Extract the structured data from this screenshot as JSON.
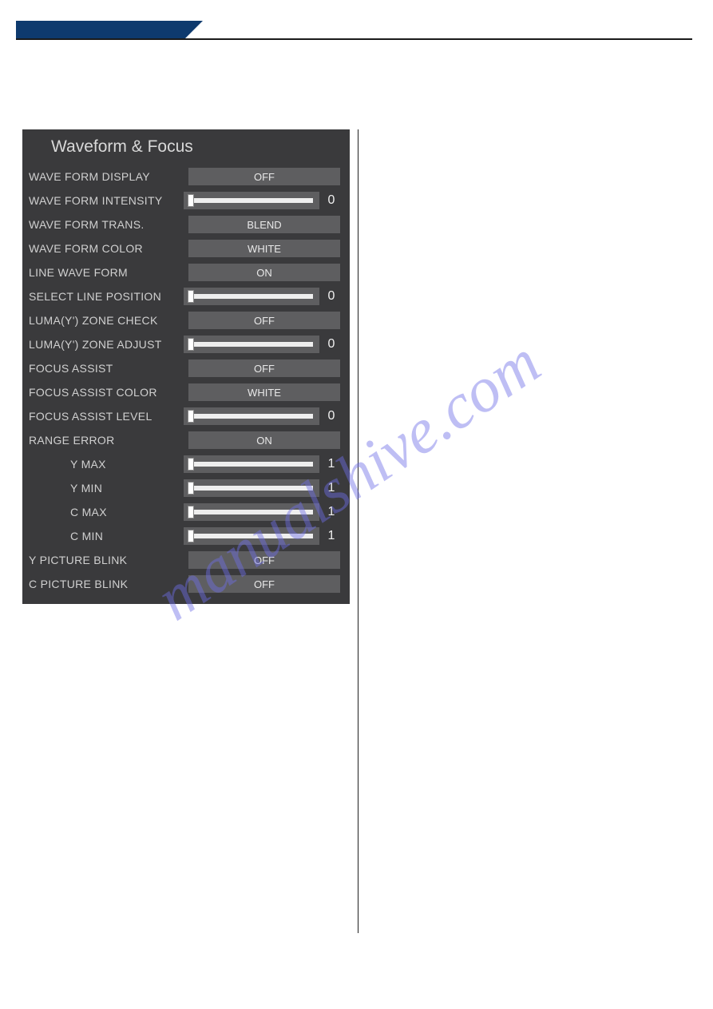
{
  "panel": {
    "title": "Waveform & Focus",
    "rows": [
      {
        "label": "WAVE FORM DISPLAY",
        "type": "select",
        "value": "OFF"
      },
      {
        "label": "WAVE FORM INTENSITY",
        "type": "slider",
        "value": "0"
      },
      {
        "label": "WAVE FORM TRANS.",
        "type": "select",
        "value": "BLEND"
      },
      {
        "label": "WAVE FORM COLOR",
        "type": "select",
        "value": "WHITE"
      },
      {
        "label": "LINE WAVE FORM",
        "type": "select",
        "value": "ON"
      },
      {
        "label": "SELECT LINE POSITION",
        "type": "slider",
        "value": "0"
      },
      {
        "label": "LUMA(Y') ZONE CHECK",
        "type": "select",
        "value": "OFF"
      },
      {
        "label": "LUMA(Y') ZONE ADJUST",
        "type": "slider",
        "value": "0"
      },
      {
        "label": "FOCUS ASSIST",
        "type": "select",
        "value": "OFF"
      },
      {
        "label": "FOCUS ASSIST COLOR",
        "type": "select",
        "value": "WHITE"
      },
      {
        "label": "FOCUS ASSIST LEVEL",
        "type": "slider",
        "value": "0"
      },
      {
        "label": "RANGE ERROR",
        "type": "select",
        "value": "ON"
      },
      {
        "label": "Y MAX",
        "type": "slider",
        "value": "1",
        "indent": true
      },
      {
        "label": "Y MIN",
        "type": "slider",
        "value": "1",
        "indent": true
      },
      {
        "label": "C MAX",
        "type": "slider",
        "value": "1",
        "indent": true
      },
      {
        "label": "C MIN",
        "type": "slider",
        "value": "1",
        "indent": true
      },
      {
        "label": "Y PICTURE BLINK",
        "type": "select",
        "value": "OFF"
      },
      {
        "label": "C PICTURE BLINK",
        "type": "select",
        "value": "OFF"
      }
    ]
  },
  "watermark": "manualshive.com"
}
